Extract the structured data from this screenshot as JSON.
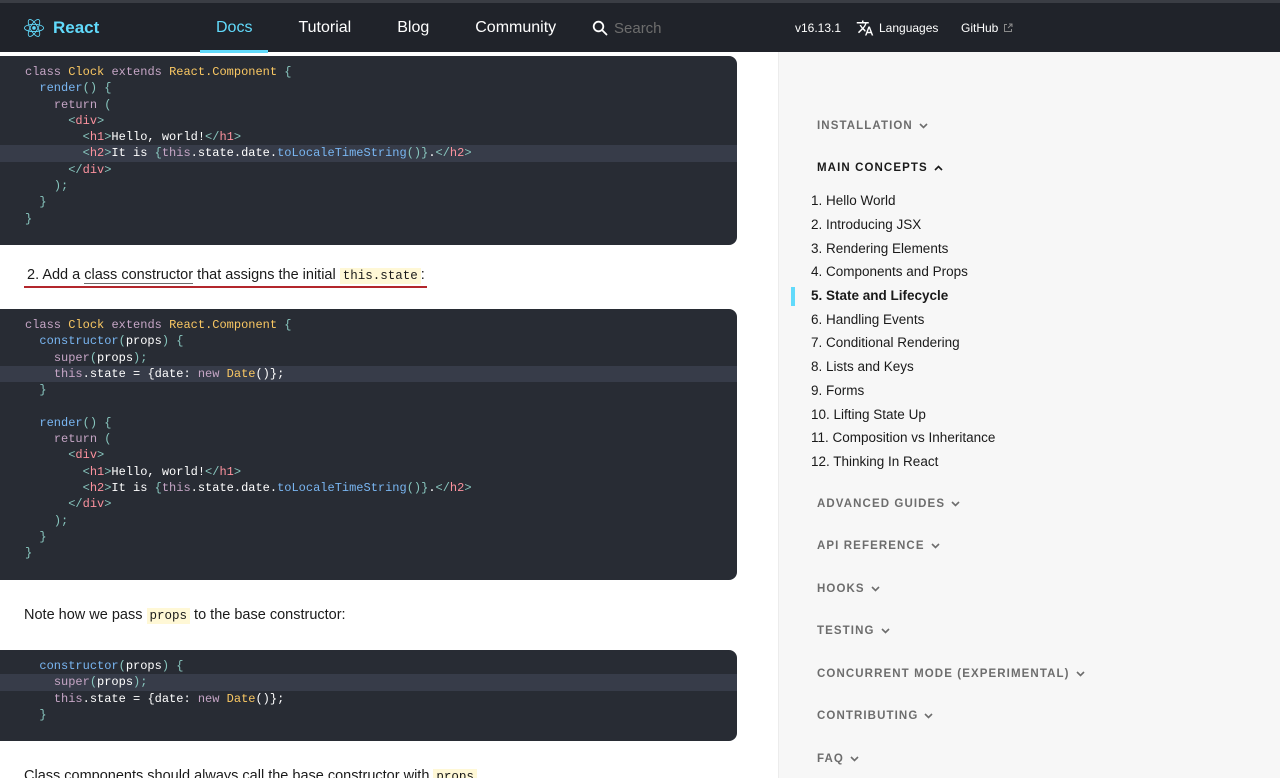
{
  "nav": {
    "brand": "React",
    "links": [
      {
        "label": "Docs",
        "active": true
      },
      {
        "label": "Tutorial",
        "active": false
      },
      {
        "label": "Blog",
        "active": false
      },
      {
        "label": "Community",
        "active": false
      }
    ],
    "search_placeholder": "Search",
    "version": "v16.13.1",
    "languages": "Languages",
    "github": "GitHub",
    "brand_color": "#61dafb",
    "background_color": "#20232a"
  },
  "content": {
    "step2_number": "2. Add a ",
    "step2_link": "class constructor",
    "step2_mid": " that assigns the initial ",
    "step2_code": "this.state",
    "step2_end": ":",
    "note_prefix": "Note how we pass ",
    "note_code": "props",
    "note_suffix": " to the base constructor:",
    "bottom_text": "Class components should always call the base constructor with ",
    "bottom_code": "props"
  },
  "code1": {
    "l1_class": "class",
    "l1_name": "Clock",
    "l1_extends": "extends",
    "l1_base": "React.Component",
    "l1_brace": "{",
    "l2_render": "render",
    "l2_rest": "() {",
    "l3_return": "return",
    "l3_paren": "(",
    "l4_open": "<",
    "l4_tag": "div",
    "l4_close": ">",
    "l5_h1": "h1",
    "l5_text": "Hello, world!",
    "l6_h2": "h2",
    "l6_text": "It is ",
    "l6_brace_open": "{",
    "l6_this": "this",
    "l6_path": ".state.date.",
    "l6_fn": "toLocaleTimeString",
    "l6_call": "()",
    "l6_brace_close": "}",
    "l6_dot": ".",
    "l8_paren": ");",
    "l9_brace": "}",
    "l10_brace": "}"
  },
  "code2": {
    "constructor": "constructor",
    "props": "props",
    "super": "super",
    "this": "this",
    "state_assign": ".state = ",
    "date_key": "{date: ",
    "new": "new",
    "date_cls": "Date",
    "date_end": "()};"
  },
  "sidebar": {
    "sections": [
      {
        "label": "INSTALLATION",
        "open": false
      },
      {
        "label": "MAIN CONCEPTS",
        "open": true
      },
      {
        "label": "ADVANCED GUIDES",
        "open": false
      },
      {
        "label": "API REFERENCE",
        "open": false
      },
      {
        "label": "HOOKS",
        "open": false
      },
      {
        "label": "TESTING",
        "open": false
      },
      {
        "label": "CONCURRENT MODE (EXPERIMENTAL)",
        "open": false
      },
      {
        "label": "CONTRIBUTING",
        "open": false
      },
      {
        "label": "FAQ",
        "open": false
      }
    ],
    "items": [
      {
        "label": "1. Hello World"
      },
      {
        "label": "2. Introducing JSX"
      },
      {
        "label": "3. Rendering Elements"
      },
      {
        "label": "4. Components and Props"
      },
      {
        "label": "5. State and Lifecycle",
        "active": true
      },
      {
        "label": "6. Handling Events"
      },
      {
        "label": "7. Conditional Rendering"
      },
      {
        "label": "8. Lists and Keys"
      },
      {
        "label": "9. Forms"
      },
      {
        "label": "10. Lifting State Up"
      },
      {
        "label": "11. Composition vs Inheritance"
      },
      {
        "label": "12. Thinking In React"
      }
    ],
    "active_color": "#61dafb"
  },
  "icons": {
    "logo": "react-logo-icon",
    "search": "search-icon",
    "languages": "translate-icon",
    "github_external": "external-link-icon",
    "chevron": "chevron-icon"
  }
}
